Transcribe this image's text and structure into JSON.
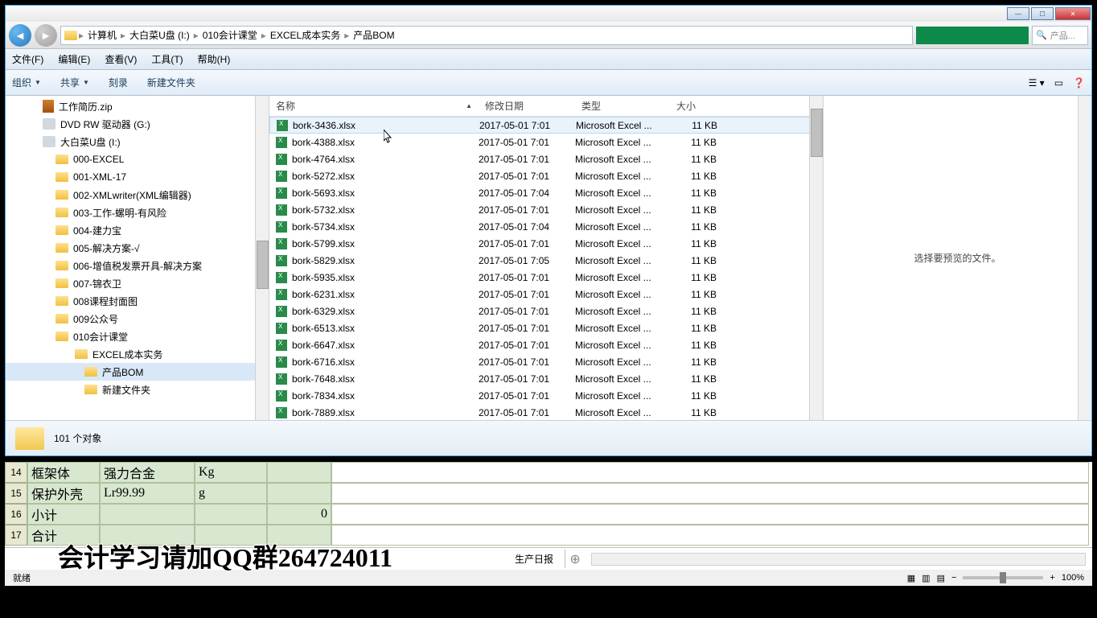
{
  "window": {
    "breadcrumb": [
      "计算机",
      "大白菜U盘 (I:)",
      "010会计课堂",
      "EXCEL成本实务",
      "产品BOM"
    ],
    "search_placeholder": "产品..."
  },
  "menubar": [
    "文件(F)",
    "编辑(E)",
    "查看(V)",
    "工具(T)",
    "帮助(H)"
  ],
  "toolbar": {
    "organize": "组织",
    "share": "共享",
    "burn": "刻录",
    "new_folder": "新建文件夹"
  },
  "tree": [
    {
      "icon": "zip",
      "label": "工作简历.zip",
      "indent": 0
    },
    {
      "icon": "drive",
      "label": "DVD RW 驱动器 (G:)",
      "indent": 0
    },
    {
      "icon": "drive",
      "label": "大白菜U盘 (I:)",
      "indent": 0
    },
    {
      "icon": "folder",
      "label": "000-EXCEL",
      "indent": 1
    },
    {
      "icon": "folder",
      "label": "001-XML-17",
      "indent": 1
    },
    {
      "icon": "folder",
      "label": "002-XMLwriter(XML编辑器)",
      "indent": 1
    },
    {
      "icon": "folder",
      "label": "003-工作-螺明-有风险",
      "indent": 1
    },
    {
      "icon": "folder",
      "label": "004-建力宝",
      "indent": 1
    },
    {
      "icon": "folder",
      "label": "005-解决方案-√",
      "indent": 1
    },
    {
      "icon": "folder",
      "label": "006-增值税发票开具-解决方案",
      "indent": 1
    },
    {
      "icon": "folder",
      "label": "007-锦衣卫",
      "indent": 1
    },
    {
      "icon": "folder",
      "label": "008课程封面图",
      "indent": 1
    },
    {
      "icon": "folder",
      "label": "009公众号",
      "indent": 1
    },
    {
      "icon": "folder",
      "label": "010会计课堂",
      "indent": 1
    },
    {
      "icon": "folder",
      "label": "EXCEL成本实务",
      "indent": 2
    },
    {
      "icon": "folder",
      "label": "产品BOM",
      "indent": 3,
      "selected": true
    },
    {
      "icon": "folder",
      "label": "新建文件夹",
      "indent": 3
    }
  ],
  "columns": {
    "name": "名称",
    "date": "修改日期",
    "type": "类型",
    "size": "大小"
  },
  "files": [
    {
      "name": "bork-3436.xlsx",
      "date": "2017-05-01 7:01",
      "type": "Microsoft Excel ...",
      "size": "11 KB",
      "hover": true
    },
    {
      "name": "bork-4388.xlsx",
      "date": "2017-05-01 7:01",
      "type": "Microsoft Excel ...",
      "size": "11 KB"
    },
    {
      "name": "bork-4764.xlsx",
      "date": "2017-05-01 7:01",
      "type": "Microsoft Excel ...",
      "size": "11 KB"
    },
    {
      "name": "bork-5272.xlsx",
      "date": "2017-05-01 7:01",
      "type": "Microsoft Excel ...",
      "size": "11 KB"
    },
    {
      "name": "bork-5693.xlsx",
      "date": "2017-05-01 7:04",
      "type": "Microsoft Excel ...",
      "size": "11 KB"
    },
    {
      "name": "bork-5732.xlsx",
      "date": "2017-05-01 7:01",
      "type": "Microsoft Excel ...",
      "size": "11 KB"
    },
    {
      "name": "bork-5734.xlsx",
      "date": "2017-05-01 7:04",
      "type": "Microsoft Excel ...",
      "size": "11 KB"
    },
    {
      "name": "bork-5799.xlsx",
      "date": "2017-05-01 7:01",
      "type": "Microsoft Excel ...",
      "size": "11 KB"
    },
    {
      "name": "bork-5829.xlsx",
      "date": "2017-05-01 7:05",
      "type": "Microsoft Excel ...",
      "size": "11 KB"
    },
    {
      "name": "bork-5935.xlsx",
      "date": "2017-05-01 7:01",
      "type": "Microsoft Excel ...",
      "size": "11 KB"
    },
    {
      "name": "bork-6231.xlsx",
      "date": "2017-05-01 7:01",
      "type": "Microsoft Excel ...",
      "size": "11 KB"
    },
    {
      "name": "bork-6329.xlsx",
      "date": "2017-05-01 7:01",
      "type": "Microsoft Excel ...",
      "size": "11 KB"
    },
    {
      "name": "bork-6513.xlsx",
      "date": "2017-05-01 7:01",
      "type": "Microsoft Excel ...",
      "size": "11 KB"
    },
    {
      "name": "bork-6647.xlsx",
      "date": "2017-05-01 7:01",
      "type": "Microsoft Excel ...",
      "size": "11 KB"
    },
    {
      "name": "bork-6716.xlsx",
      "date": "2017-05-01 7:01",
      "type": "Microsoft Excel ...",
      "size": "11 KB"
    },
    {
      "name": "bork-7648.xlsx",
      "date": "2017-05-01 7:01",
      "type": "Microsoft Excel ...",
      "size": "11 KB"
    },
    {
      "name": "bork-7834.xlsx",
      "date": "2017-05-01 7:01",
      "type": "Microsoft Excel ...",
      "size": "11 KB"
    },
    {
      "name": "bork-7889.xlsx",
      "date": "2017-05-01 7:01",
      "type": "Microsoft Excel ...",
      "size": "11 KB"
    }
  ],
  "preview_text": "选择要预览的文件。",
  "status": "101 个对象",
  "excel": {
    "rows": [
      {
        "num": "14",
        "c1": "框架体",
        "c2": "强力合金",
        "c3": "Kg",
        "c4": "",
        "c5": ""
      },
      {
        "num": "15",
        "c1": "保护外壳",
        "c2": "Lr99.99",
        "c3": "g",
        "c4": "",
        "c5": ""
      },
      {
        "num": "16",
        "c1": "小计",
        "c2": "",
        "c3": "",
        "c4": "0",
        "c5": ""
      },
      {
        "num": "17",
        "c1": "合计",
        "c2": "",
        "c3": "",
        "c4": "",
        "c5": ""
      }
    ],
    "tab": "生产日报",
    "status_left": "就绪",
    "zoom": "100%"
  },
  "watermark": "会计学习请加QQ群264724011"
}
